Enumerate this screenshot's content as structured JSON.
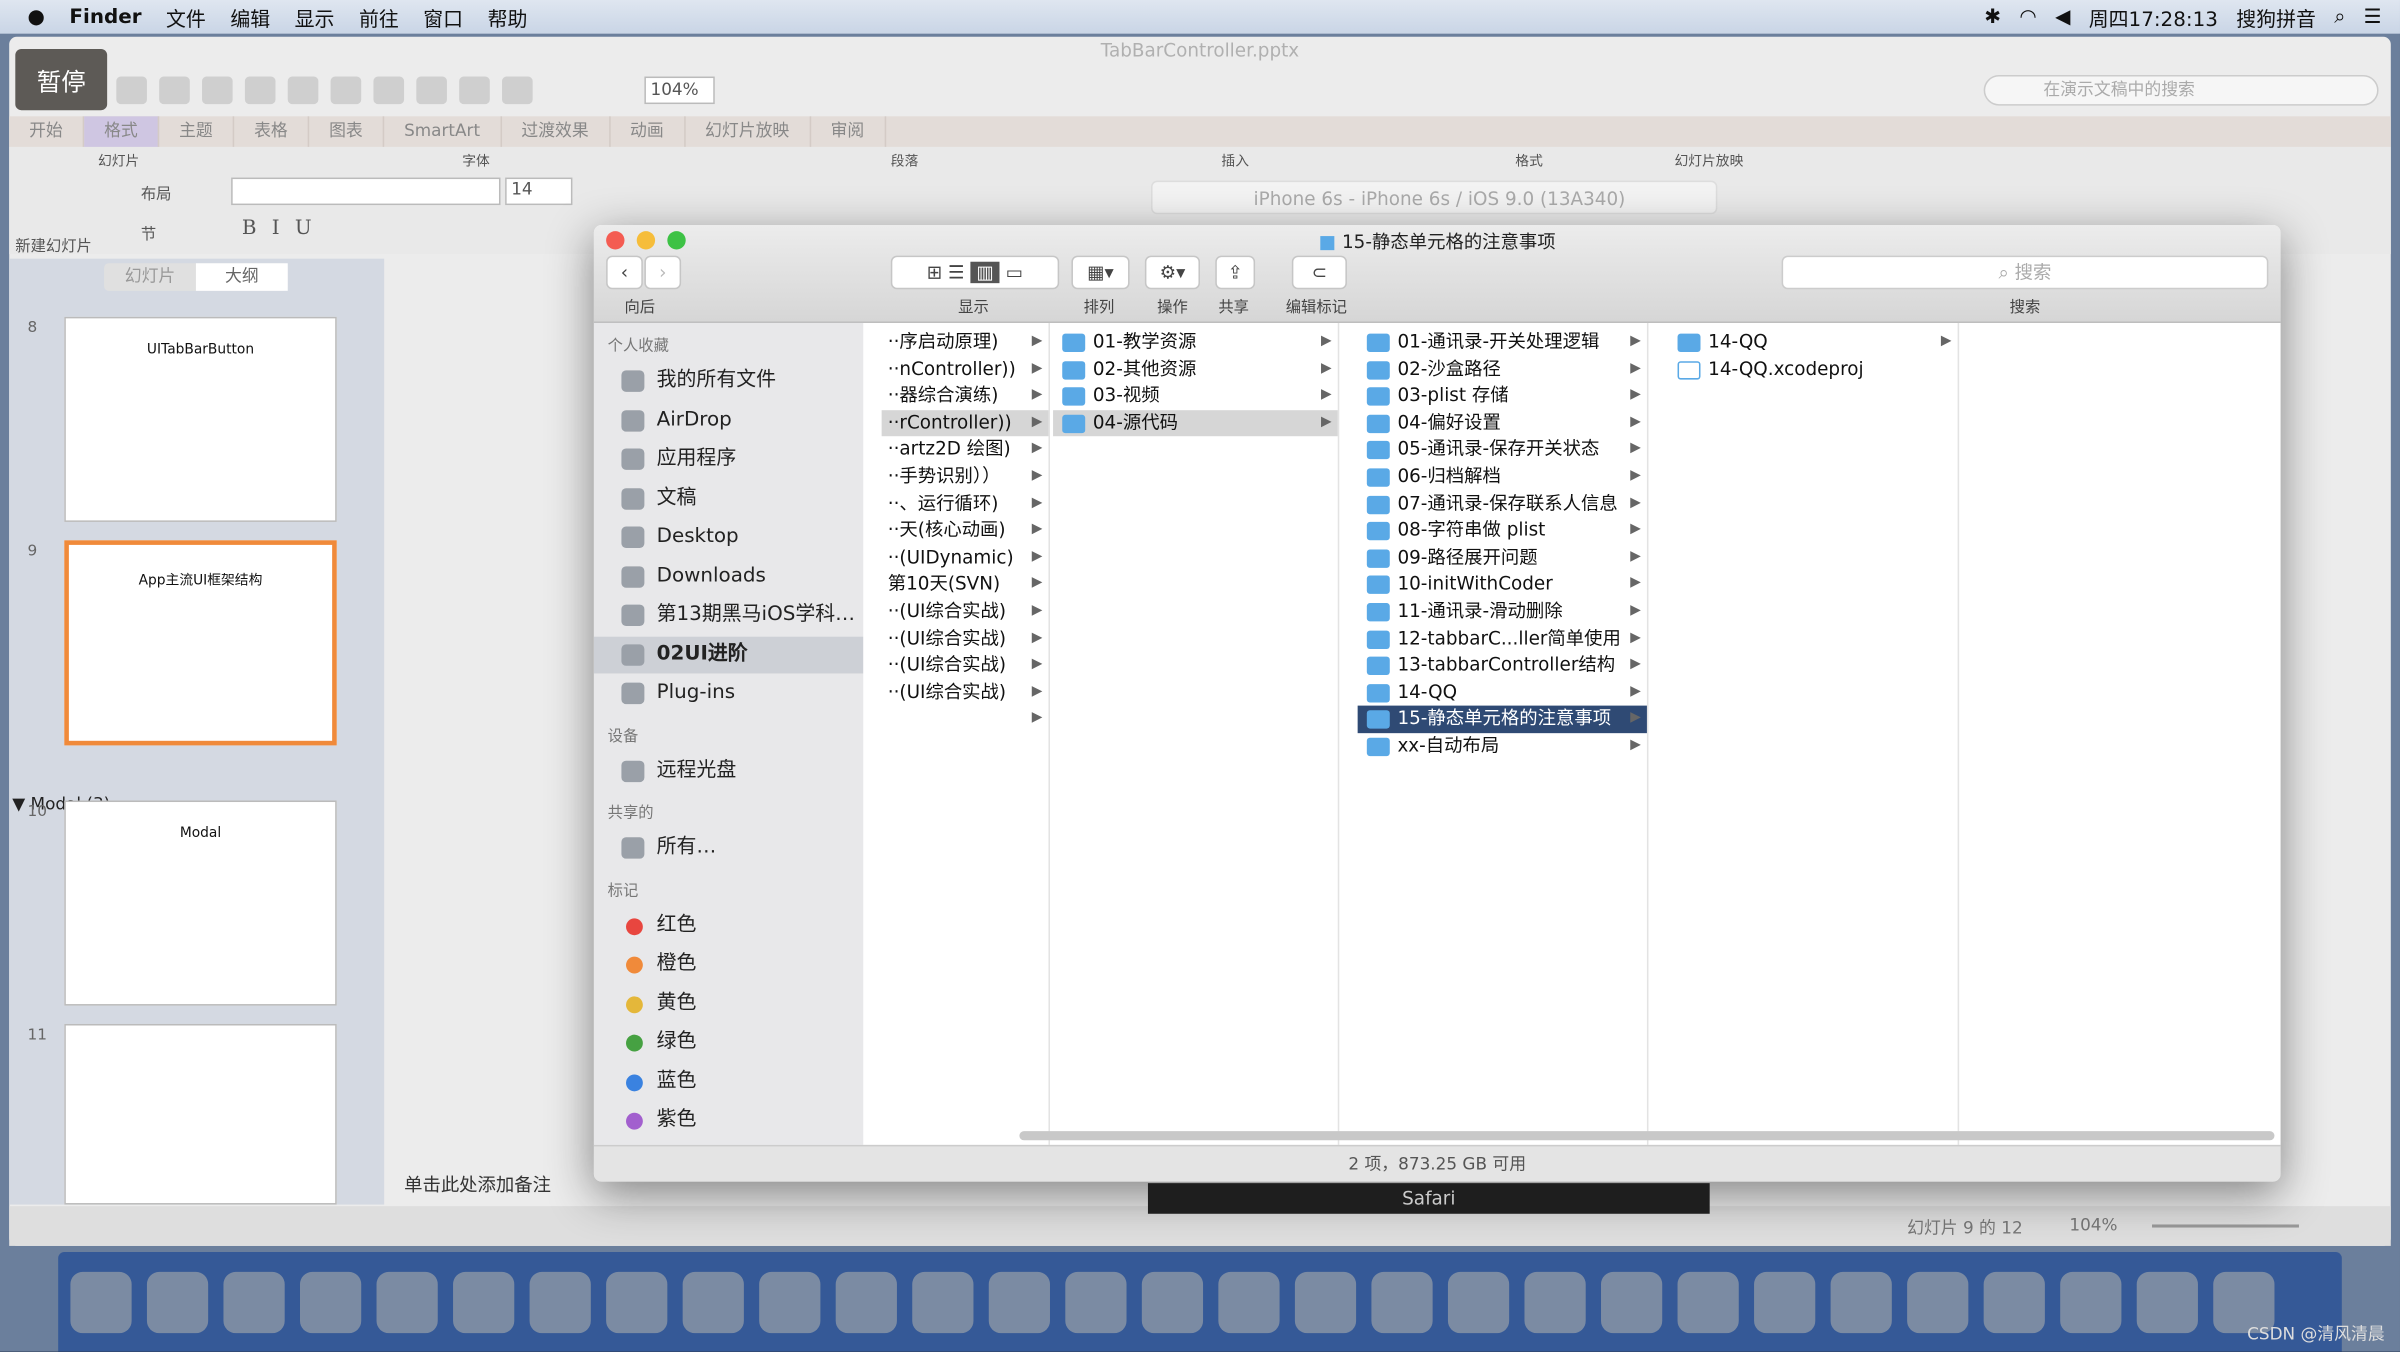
{
  "menubar": {
    "app": "Finder",
    "items": [
      "文件",
      "编辑",
      "显示",
      "前往",
      "窗口",
      "帮助"
    ],
    "clock": "周四17:28:13",
    "ime": "搜狗拼音"
  },
  "ppt": {
    "title": "TabBarController.pptx",
    "pause": "暂停",
    "zoom": "104%",
    "search_placeholder": "在演示文稿中的搜索",
    "ribbon": [
      "开始",
      "格式",
      "主题",
      "表格",
      "图表",
      "SmartArt",
      "过渡效果",
      "动画",
      "幻灯片放映",
      "审阅"
    ],
    "groups": [
      "幻灯片",
      "字体",
      "段落",
      "插入",
      "格式",
      "幻灯片放映"
    ],
    "layout": "布局",
    "section_btn": "节",
    "new_slide": "新建幻灯片",
    "font_size": "14",
    "simulator": "iPhone 6s - iPhone 6s / iOS 9.0 (13A340)",
    "pane_tabs": [
      "幻灯片",
      "大纲"
    ],
    "slides": [
      {
        "num": "8",
        "title": "UITabBarButton"
      },
      {
        "num": "9",
        "title": "App主流UI框架结构"
      },
      {
        "num": "10",
        "title": "Modal"
      },
      {
        "num": "11",
        "title": ""
      }
    ],
    "section": "▼ Modal (3)",
    "notes": "单击此处添加备注",
    "status": "幻灯片 9 的 12",
    "status_zoom": "104%"
  },
  "finder": {
    "title": "15-静态单元格的注意事项",
    "toolbar_labels": {
      "back": "向后",
      "view": "显示",
      "arrange": "排列",
      "action": "操作",
      "share": "共享",
      "tags": "编辑标记",
      "search": "搜索"
    },
    "search_placeholder": "搜索",
    "sidebar": {
      "favorites": "个人收藏",
      "fav_items": [
        "我的所有文件",
        "AirDrop",
        "应用程序",
        "文稿",
        "Desktop",
        "Downloads",
        "第13期黑马iOS学科…",
        "02UI进阶",
        "Plug-ins"
      ],
      "selected": "02UI进阶",
      "devices": "设备",
      "device_items": [
        "远程光盘"
      ],
      "shared": "共享的",
      "shared_items": [
        "所有…"
      ],
      "tags": "标记",
      "tag_items": [
        {
          "name": "红色",
          "color": "#e8463f"
        },
        {
          "name": "橙色",
          "color": "#f08a3a"
        },
        {
          "name": "黄色",
          "color": "#e4b73a"
        },
        {
          "name": "绿色",
          "color": "#46a142"
        },
        {
          "name": "蓝色",
          "color": "#3a82e0"
        },
        {
          "name": "紫色",
          "color": "#a25fce"
        }
      ]
    },
    "columns": [
      [
        "··序启动原理)",
        "··nController))",
        "··器综合演练)",
        "··rController))",
        "··artz2D 绘图)",
        "··手势识别））",
        "··、运行循环)",
        "··天(核心动画)",
        "··(UIDynamic)",
        "第10天(SVN)",
        "··(UI综合实战)",
        "··(UI综合实战)",
        "··(UI综合实战)",
        "··(UI综合实战)",
        ""
      ],
      [
        "01-教学资源",
        "02-其他资源",
        "03-视频",
        "04-源代码"
      ],
      [
        "01-通讯录-开关处理逻辑",
        "02-沙盒路径",
        "03-plist 存储",
        "04-偏好设置",
        "05-通讯录-保存开关状态",
        "06-归档解档",
        "07-通讯录-保存联系人信息",
        "08-字符串做 plist",
        "09-路径展开问题",
        "10-initWithCoder",
        "11-通讯录-滑动删除",
        "12-tabbarC...ller简单使用",
        "13-tabbarController结构",
        "14-QQ",
        "15-静态单元格的注意事项",
        "xx-自动布局"
      ],
      [
        "14-QQ",
        "14-QQ.xcodeproj"
      ]
    ],
    "status": "2 项，873.25 GB 可用"
  },
  "tooltip": "Safari",
  "watermark": "CSDN @清风清晨"
}
